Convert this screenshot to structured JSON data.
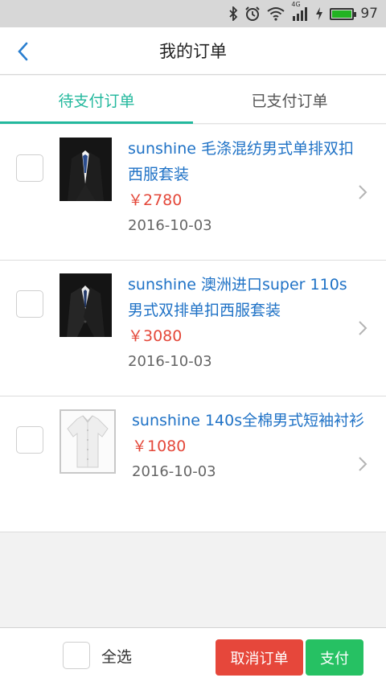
{
  "status_bar": {
    "network": "4G",
    "battery": "97"
  },
  "nav": {
    "title": "我的订单"
  },
  "tabs": [
    {
      "label": "待支付订单",
      "active": true
    },
    {
      "label": "已支付订单",
      "active": false
    }
  ],
  "orders": [
    {
      "name": "sunshine 毛涤混纺男式单排双扣西服套装",
      "price": "￥2780",
      "date": "2016-10-03",
      "image": "suit-thumbnail"
    },
    {
      "name": "sunshine 澳洲进口super 110s男式双排单扣西服套装",
      "price": "￥3080",
      "date": "2016-10-03",
      "image": "suit-thumbnail"
    },
    {
      "name": "sunshine 140s全棉男式短袖衬衫",
      "price": "￥1080",
      "date": "2016-10-03",
      "image": "shirt-thumbnail"
    }
  ],
  "footer": {
    "select_all_label": "全选",
    "cancel_label": "取消订单",
    "pay_label": "支付"
  },
  "colors": {
    "accent": "#23b89d",
    "link": "#1f72c6",
    "price": "#e4483a",
    "cancel": "#e6473b",
    "pay": "#26c163"
  }
}
